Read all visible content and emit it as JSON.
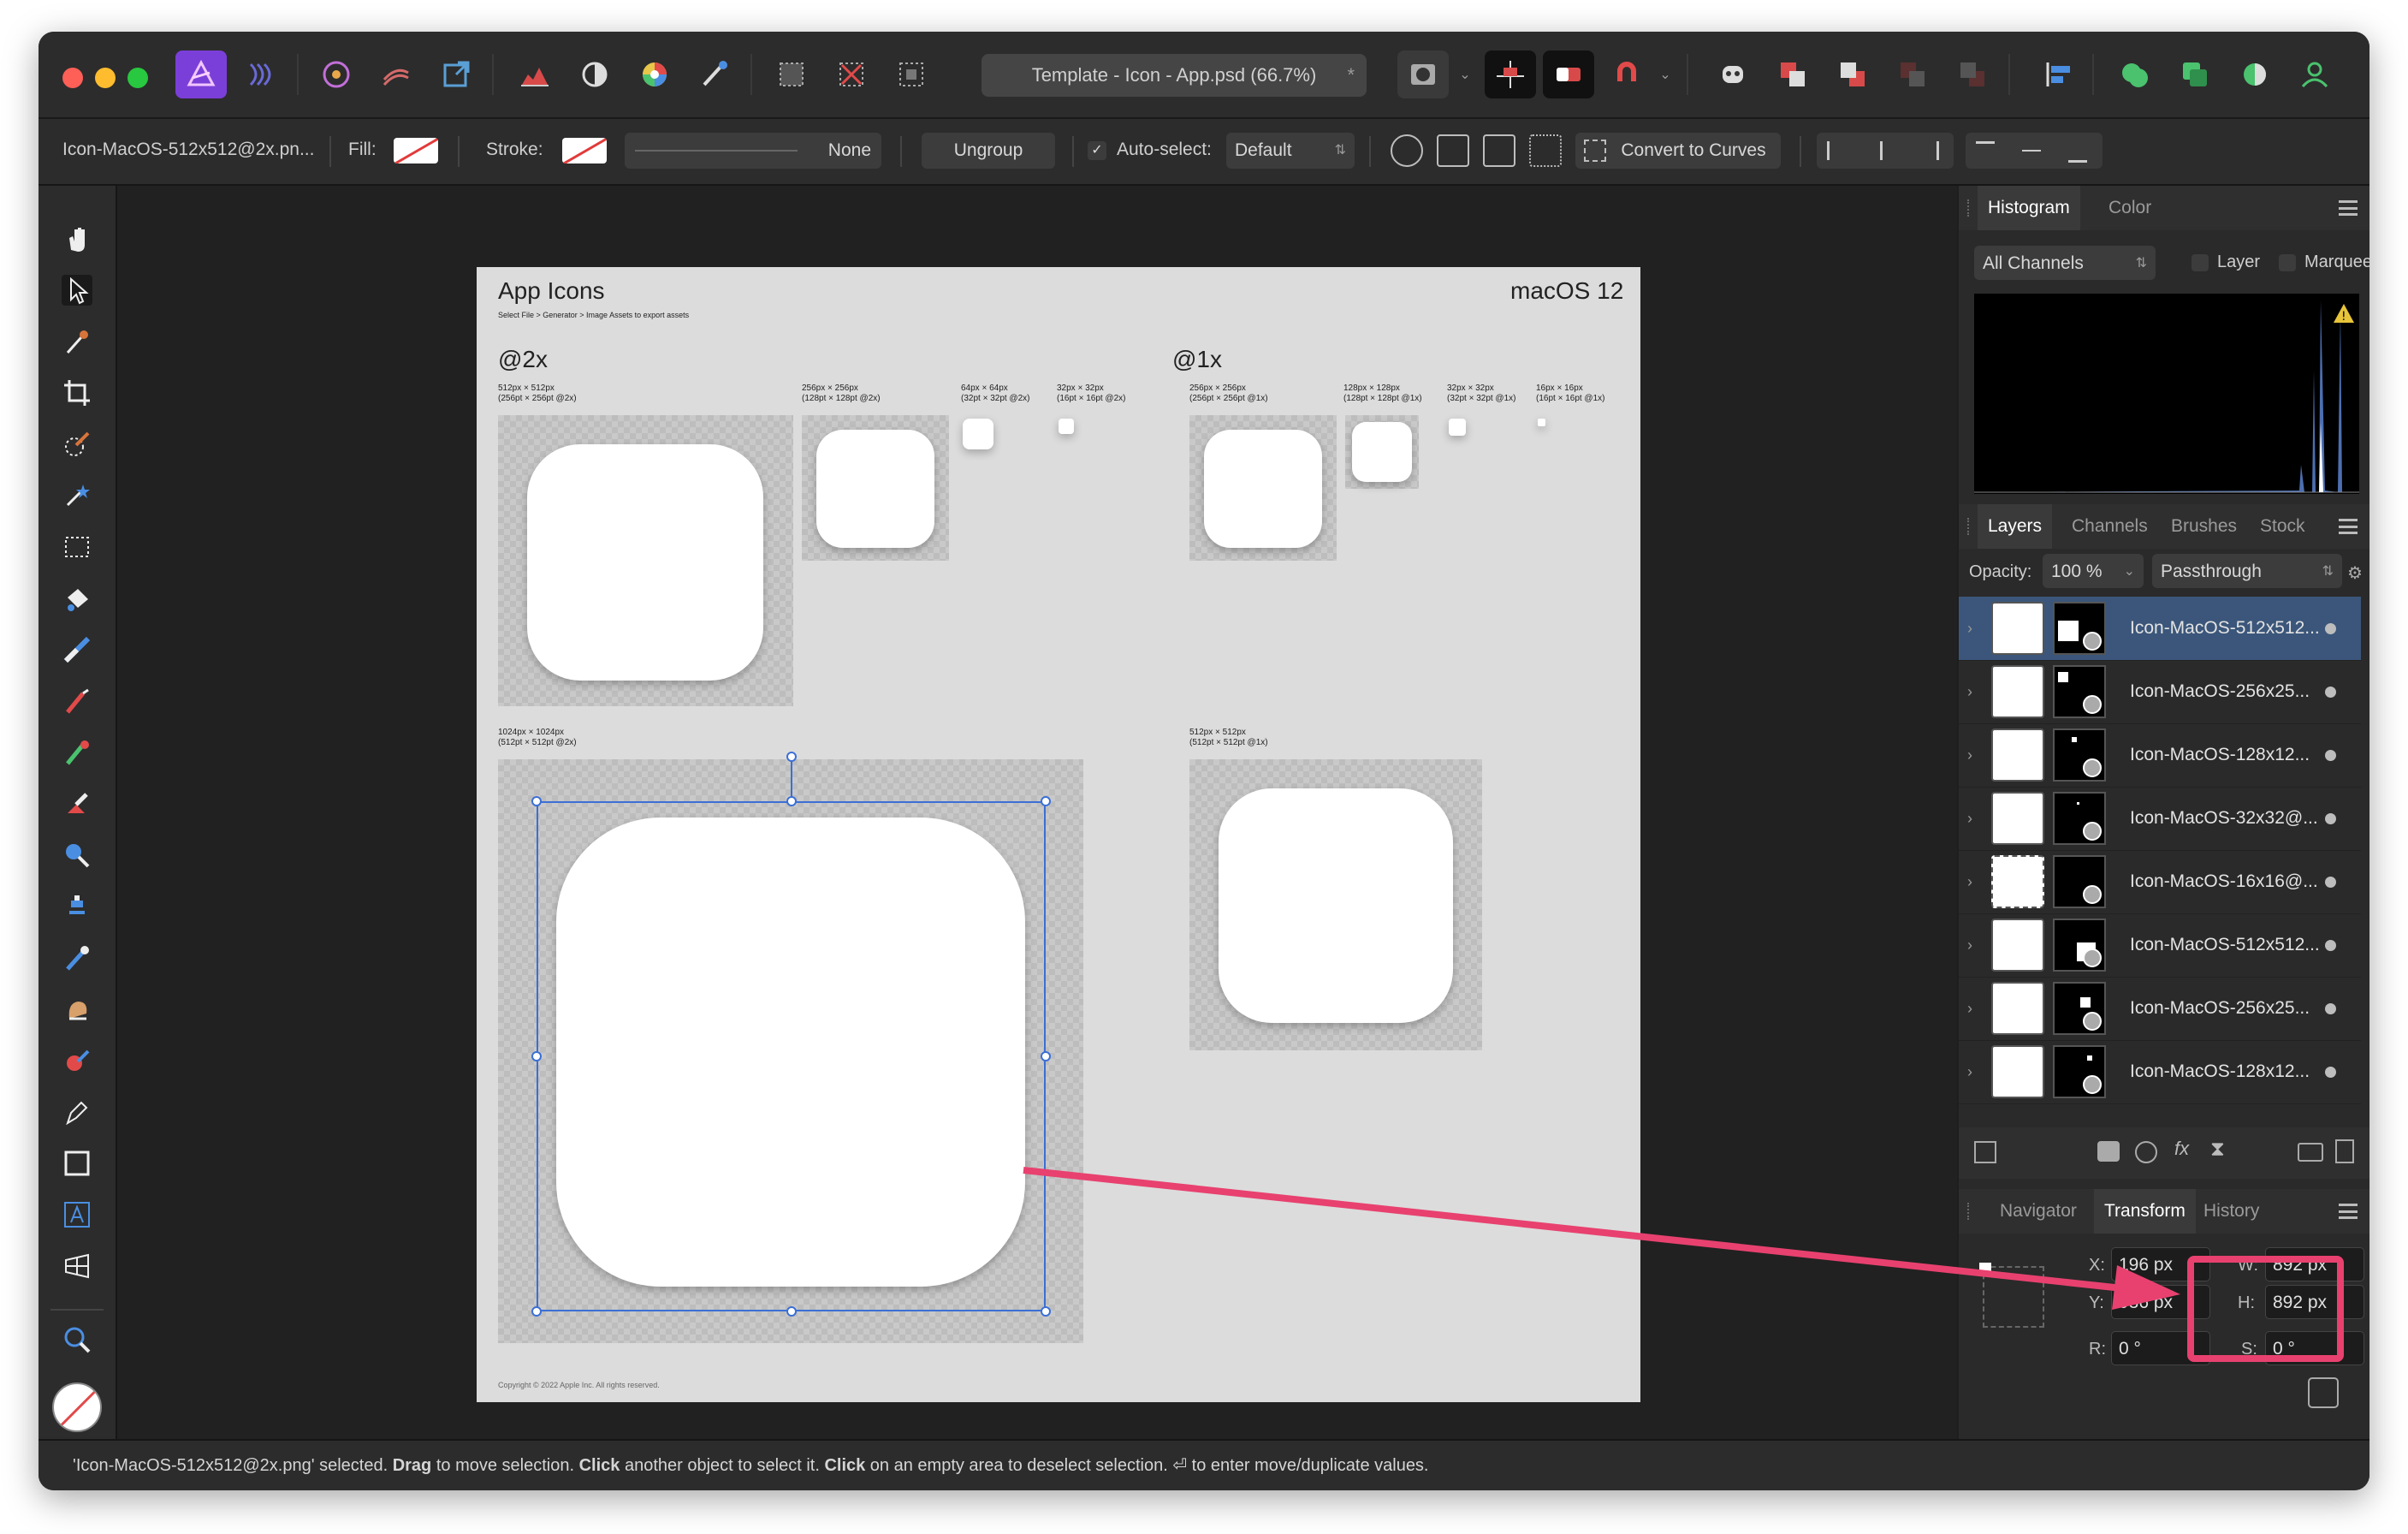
{
  "window": {
    "doc_title": "Template - Icon - App.psd (66.7%)",
    "doc_star": "*"
  },
  "toolbar_icons": [
    "affinity-photo-icon",
    "liquify-persona-icon",
    "develop-persona-icon",
    "tone-mapping-persona-icon",
    "export-persona-icon",
    "histogram-view-icon",
    "color-wheel-icon",
    "brushes-icon",
    "selection-brush-icon",
    "marquee-icon",
    "clear-selection-icon",
    "invert-selection-icon"
  ],
  "context": {
    "layer_name": "Icon-MacOS-512x512@2x.pn...",
    "fill_label": "Fill:",
    "stroke_label": "Stroke:",
    "stroke_value": "None",
    "ungroup_label": "Ungroup",
    "autoselect_label": "Auto-select:",
    "autoselect_value": "Default",
    "convert_label": "Convert to Curves"
  },
  "canvas": {
    "page_title": "App Icons",
    "page_subtitle": "Select File > Generator > Image Assets to export assets",
    "os_label": "macOS 12",
    "at2x": "@2x",
    "at1x": "@1x",
    "labels": {
      "a": "512px × 512px\n(256pt × 256pt @2x)",
      "b": "256px × 256px\n(128pt × 128pt @2x)",
      "c": "64px × 64px\n(32pt × 32pt @2x)",
      "d": "32px × 32px\n(16pt × 16pt @2x)",
      "e": "256px × 256px\n(256pt × 256pt @1x)",
      "f": "128px × 128px\n(128pt × 128pt @1x)",
      "g": "32px × 32px\n(32pt × 32pt @1x)",
      "h": "16px × 16px\n(16pt × 16pt @1x)",
      "i": "1024px × 1024px\n(512pt × 512pt @2x)",
      "j": "512px × 512px\n(512pt × 512pt @1x)"
    },
    "copyright": "Copyright © 2022 Apple Inc. All rights reserved."
  },
  "histogram": {
    "tab_active": "Histogram",
    "tab_other": "Color",
    "channel": "All Channels",
    "layer_label": "Layer",
    "marquee_label": "Marquee"
  },
  "layers": {
    "tabs": [
      "Layers",
      "Channels",
      "Brushes",
      "Stock"
    ],
    "opacity_label": "Opacity:",
    "opacity_value": "100 %",
    "blend": "Passthrough",
    "rows": [
      {
        "name": "Icon-MacOS-512x512..."
      },
      {
        "name": "Icon-MacOS-256x25..."
      },
      {
        "name": "Icon-MacOS-128x12..."
      },
      {
        "name": "Icon-MacOS-32x32@..."
      },
      {
        "name": "Icon-MacOS-16x16@..."
      },
      {
        "name": "Icon-MacOS-512x512..."
      },
      {
        "name": "Icon-MacOS-256x25..."
      },
      {
        "name": "Icon-MacOS-128x12..."
      }
    ]
  },
  "transform": {
    "tabs": [
      "Navigator",
      "Transform",
      "History"
    ],
    "x_label": "X:",
    "x_value": "196 px",
    "y_label": "Y:",
    "y_value": "936 px",
    "w_label": "W:",
    "w_value": "892 px",
    "h_label": "H:",
    "h_value": "892 px",
    "r_label": "R:",
    "r_value": "0 °",
    "s_label": "S:",
    "s_value": "0 °"
  },
  "status": {
    "p1": "'Icon-MacOS-512x512@2x.png' selected. ",
    "b1": "Drag",
    "p2": " to move selection. ",
    "b2": "Click",
    "p3": " another object to select it. ",
    "b3": "Click",
    "p4": " on an empty area to deselect selection. ⏎ to enter move/duplicate values."
  },
  "colors": {
    "accent": "#3b6fd6",
    "highlight": "#e8416f"
  }
}
